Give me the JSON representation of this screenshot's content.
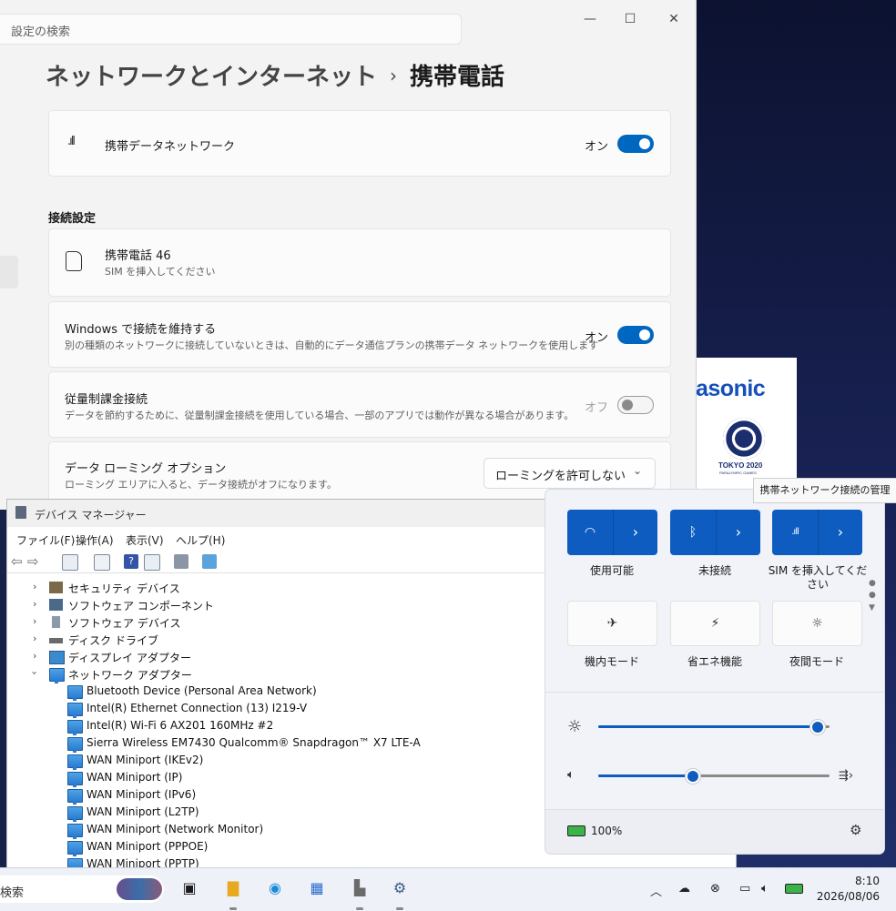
{
  "settings": {
    "search_placeholder": "設定の検索",
    "breadcrumb_parent": "ネットワークとインターネット",
    "breadcrumb_sep": "›",
    "breadcrumb_current": "携帯電話",
    "cellular": {
      "label": "携帯データネットワーク",
      "state": "オン"
    },
    "section_title": "接続設定",
    "sim": {
      "title": "携帯電話 46",
      "sub": "SIM を挿入してください"
    },
    "keep_connected": {
      "title": "Windows で接続を維持する",
      "sub": "別の種類のネットワークに接続していないときは、自動的にデータ通信プランの携帯データ ネットワークを使用します",
      "state": "オン"
    },
    "metered": {
      "title": "従量制課金接続",
      "sub": "データを節約するために、従量制課金接続を使用している場合、一部のアプリでは動作が異なる場合があります。",
      "state": "オフ"
    },
    "roaming": {
      "title": "データ ローミング オプション",
      "sub": "ローミング エリアに入ると、データ接続がオフになります。",
      "value": "ローミングを許可しない"
    }
  },
  "wallpaper": {
    "brand": "asonic",
    "games": "TOKYO 2020",
    "games_sub": "PARALYMPIC GAMES"
  },
  "devmgr": {
    "title": "デバイス マネージャー",
    "menu": [
      "ファイル(F)",
      "操作(A)",
      "表示(V)",
      "ヘルプ(H)"
    ],
    "categories": [
      "セキュリティ デバイス",
      "ソフトウェア コンポーネント",
      "ソフトウェア デバイス",
      "ディスク ドライブ",
      "ディスプレイ アダプター",
      "ネットワーク アダプター"
    ],
    "adapters": [
      "Bluetooth Device (Personal Area Network)",
      "Intel(R) Ethernet Connection (13) I219-V",
      "Intel(R) Wi-Fi 6 AX201 160MHz #2",
      "Sierra Wireless EM7430 Qualcomm® Snapdragon™ X7 LTE-A",
      "WAN Miniport (IKEv2)",
      "WAN Miniport (IP)",
      "WAN Miniport (IPv6)",
      "WAN Miniport (L2TP)",
      "WAN Miniport (Network Monitor)",
      "WAN Miniport (PPPOE)",
      "WAN Miniport (PPTP)"
    ]
  },
  "quick": {
    "tooltip": "携帯ネットワーク接続の管理",
    "wifi_label": "使用可能",
    "bt_label": "未接続",
    "cell_label": "SIM を挿入してください",
    "airplane_label": "機内モード",
    "saver_label": "省エネ機能",
    "night_label": "夜間モード",
    "brightness": 0.95,
    "volume": 0.41,
    "battery": "100%"
  },
  "taskbar": {
    "search": "検索",
    "time": "8:10",
    "date": "2026/08/06"
  },
  "colors": {
    "accent": "#0067c0",
    "tile_on": "#0f5cc0"
  }
}
